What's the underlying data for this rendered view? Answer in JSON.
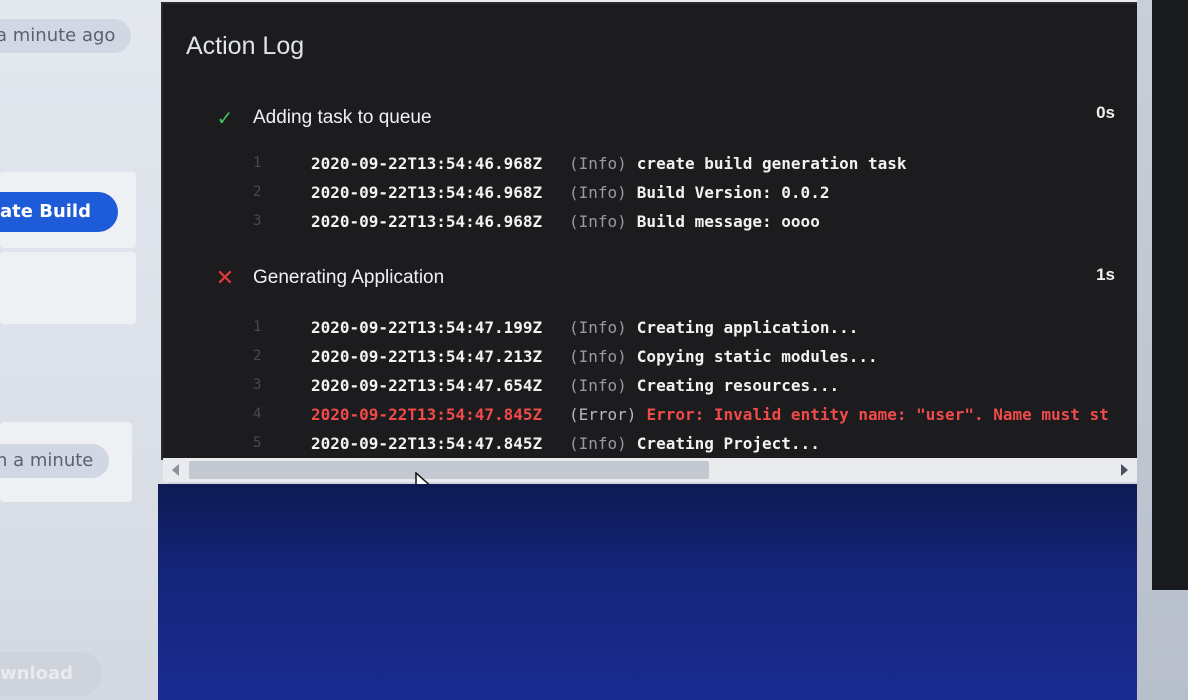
{
  "left": {
    "top_time": "a minute ago",
    "primary_button": "ate Build",
    "mid_time": "n a minute",
    "download_button": "wnload"
  },
  "log": {
    "title": "Action Log",
    "steps": [
      {
        "label": "Adding task to queue",
        "status": "success",
        "duration": "0s",
        "lines": [
          {
            "num": "1",
            "time": "2020-09-22T13:54:46.968Z",
            "level": "(Info)",
            "message": "create build generation task"
          },
          {
            "num": "2",
            "time": "2020-09-22T13:54:46.968Z",
            "level": "(Info)",
            "message": "Build Version: 0.0.2"
          },
          {
            "num": "3",
            "time": "2020-09-22T13:54:46.968Z",
            "level": "(Info)",
            "message": "Build message: oooo"
          }
        ]
      },
      {
        "label": "Generating Application",
        "status": "error",
        "duration": "1s",
        "lines": [
          {
            "num": "1",
            "time": "2020-09-22T13:54:47.199Z",
            "level": "(Info)",
            "message": "Creating application..."
          },
          {
            "num": "2",
            "time": "2020-09-22T13:54:47.213Z",
            "level": "(Info)",
            "message": "Copying static modules..."
          },
          {
            "num": "3",
            "time": "2020-09-22T13:54:47.654Z",
            "level": "(Info)",
            "message": "Creating resources..."
          },
          {
            "num": "4",
            "time": "2020-09-22T13:54:47.845Z",
            "level": "(Error)",
            "message": "Error: Invalid entity name: \"user\". Name must st"
          },
          {
            "num": "5",
            "time": "2020-09-22T13:54:47.845Z",
            "level": "(Info)",
            "message": "Creating Project..."
          }
        ]
      }
    ]
  },
  "icons": {
    "success": "check-icon",
    "error": "cross-icon",
    "scroll_left": "chevron-left-icon",
    "scroll_right": "chevron-right-icon"
  },
  "colors": {
    "primary": "#1e5bd9",
    "success": "#3fbf5f",
    "error": "#f04a4a",
    "panel": "#1c1c1e"
  }
}
